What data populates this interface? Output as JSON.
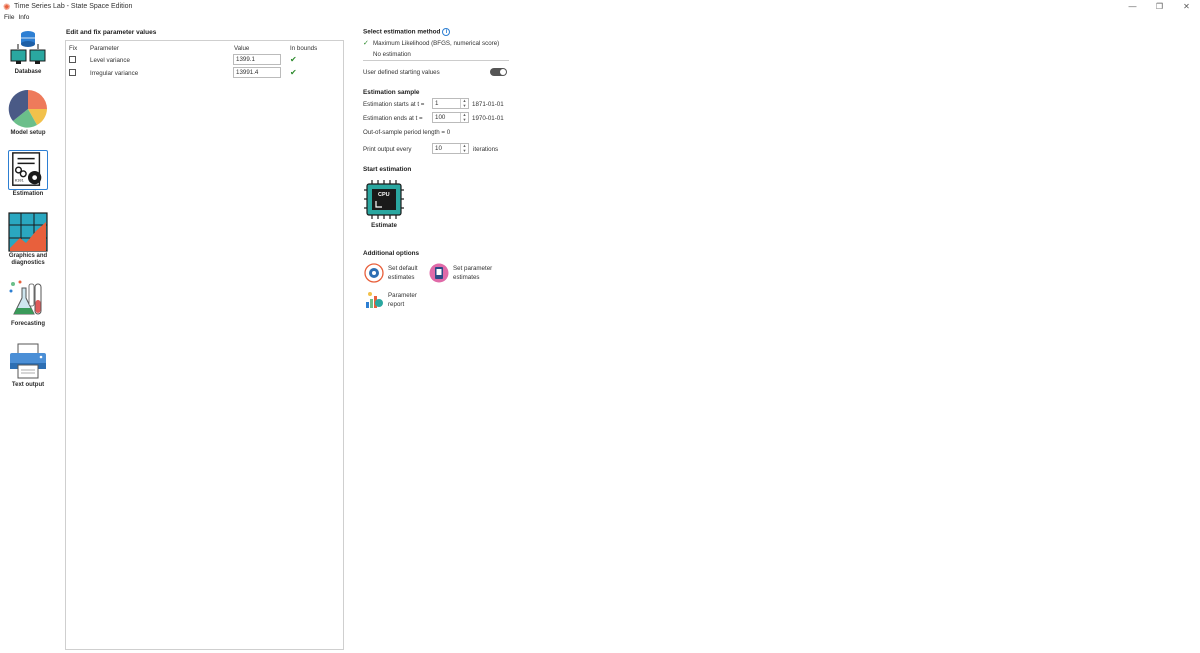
{
  "window": {
    "title": "Time Series Lab - State Space Edition",
    "controls": [
      "—",
      "❐",
      "✕"
    ]
  },
  "menu": [
    "File",
    "Info"
  ],
  "sidebar": {
    "items": [
      {
        "label": "Database",
        "icon": "database-icon"
      },
      {
        "label": "Model setup",
        "icon": "pie-chart-icon"
      },
      {
        "label": "Estimation",
        "icon": "estimation-gears-icon",
        "active": true
      },
      {
        "label": "Graphics and diagnostics",
        "icon": "graphics-icon"
      },
      {
        "label": "Forecasting",
        "icon": "forecasting-flask-icon"
      },
      {
        "label": "Text output",
        "icon": "printer-icon"
      }
    ]
  },
  "params": {
    "title": "Edit and fix parameter values",
    "headers": {
      "fix": "Fix",
      "parameter": "Parameter",
      "value": "Value",
      "bounds": "In bounds"
    },
    "rows": [
      {
        "name": "Level variance",
        "value": "1399.1",
        "in_bounds": "✔"
      },
      {
        "name": "Irregular variance",
        "value": "13991.4",
        "in_bounds": "✔"
      }
    ]
  },
  "method": {
    "title": "Select estimation method",
    "options": [
      {
        "label": "Maximum Likelihood (BFGS, numerical score)",
        "check": "✓"
      },
      {
        "label": "No estimation",
        "check": ""
      }
    ]
  },
  "user_defined": {
    "label": "User defined starting values"
  },
  "sample": {
    "title": "Estimation sample",
    "start_label": "Estimation starts at t =",
    "start_value": "1",
    "start_date": "1871-01-01",
    "end_label": "Estimation ends at t =",
    "end_value": "100",
    "end_date": "1970-01-01",
    "oos_label": "Out-of-sample period length = 0",
    "print_label": "Print output every",
    "print_value": "10",
    "iterations_label": "iterations"
  },
  "start": {
    "title": "Start estimation",
    "button_label": "Estimate",
    "chip_text": "CPU"
  },
  "additional": {
    "title": "Additional options",
    "set_default": "Set default estimates",
    "set_parameter": "Set parameter estimates",
    "param_report": "Parameter report"
  },
  "colors": {
    "accent": "#2d7fd3",
    "ok": "#2e8b2e",
    "brand": "#e8603c"
  }
}
